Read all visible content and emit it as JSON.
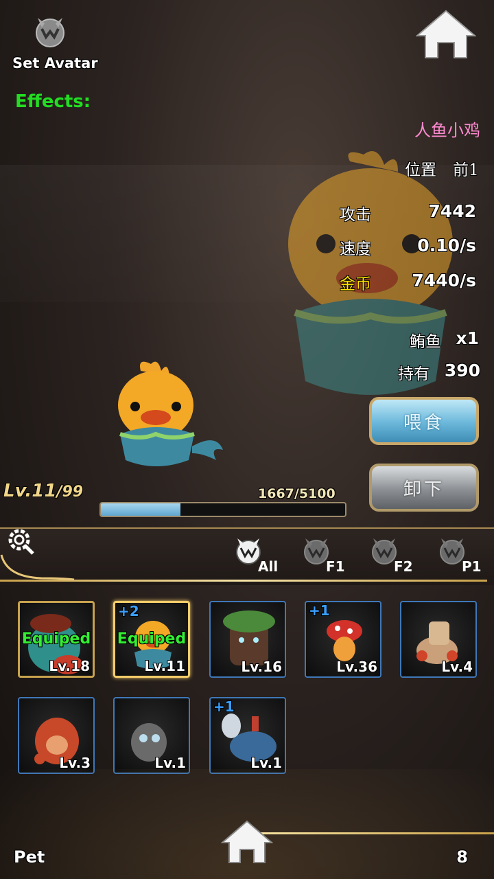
{
  "header": {
    "avatar_icon": "wolf-logo-icon",
    "set_avatar_label": "Set Avatar",
    "effects_label": "Effects:",
    "home_icon": "home-icon"
  },
  "pet": {
    "name": "人鱼小鸡",
    "position_label": "位置",
    "position_value": "前1",
    "stats": [
      {
        "label": "攻击",
        "value": "7442"
      },
      {
        "label": "速度",
        "value": "0.10/s"
      },
      {
        "label": "金币",
        "value": "7440/s"
      }
    ],
    "items": [
      {
        "label": "鲔鱼",
        "value": "x1"
      },
      {
        "label": "持有",
        "value": "390"
      }
    ],
    "level": "Lv.11",
    "max_level": "/99",
    "exp_text": "1667/5100",
    "exp_fraction": 0.327
  },
  "buttons": {
    "feed": "喂食",
    "unload": "卸下"
  },
  "filter": {
    "settings_icon": "gear-icon",
    "tabs": [
      {
        "label": "All",
        "icon": "wolf-logo-icon",
        "active": true
      },
      {
        "label": "F1",
        "icon": "wolf-logo-icon",
        "active": false
      },
      {
        "label": "F2",
        "icon": "wolf-logo-icon",
        "active": false
      },
      {
        "label": "P1",
        "icon": "wolf-logo-icon",
        "active": false
      }
    ]
  },
  "pets_grid": [
    {
      "level": "Lv.18",
      "plus": "",
      "equipped": "Equiped",
      "style": "gold"
    },
    {
      "level": "Lv.11",
      "plus": "+2",
      "equipped": "Equiped",
      "style": "selected"
    },
    {
      "level": "Lv.16",
      "plus": "",
      "equipped": "",
      "style": "blue"
    },
    {
      "level": "Lv.36",
      "plus": "+1",
      "equipped": "",
      "style": "blue"
    },
    {
      "level": "Lv.4",
      "plus": "",
      "equipped": "",
      "style": "blue"
    },
    {
      "level": "Lv.3",
      "plus": "",
      "equipped": "",
      "style": "blue"
    },
    {
      "level": "Lv.1",
      "plus": "",
      "equipped": "",
      "style": "blue"
    },
    {
      "level": "Lv.1",
      "plus": "+1",
      "equipped": "",
      "style": "blue"
    }
  ],
  "footer": {
    "pet_label": "Pet",
    "count": "8"
  },
  "colors": {
    "name_pink": "#ff8ad0",
    "effects_green": "#22dd22",
    "gold_text": "#f2d78a",
    "card_blue": "#3f78b8"
  }
}
